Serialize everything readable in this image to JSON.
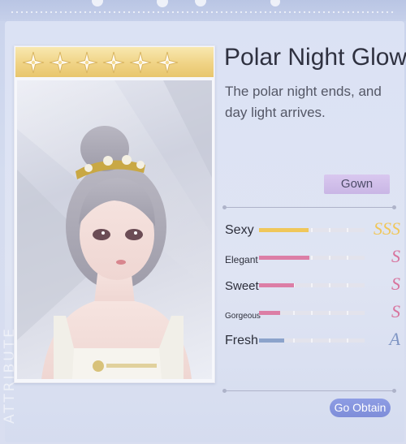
{
  "side_text": "ATTRIBUTE",
  "card": {
    "star_count": 6,
    "star_icon": "sparkle-star-icon"
  },
  "outfit": {
    "title": "Polar Night Glow",
    "description": "The polar night ends, and day light arrives.",
    "category": "Gown"
  },
  "attributes": [
    {
      "name": "Sexy",
      "grade": "SSS",
      "fill": 0.47,
      "color": "#f0c75a",
      "grade_color": "#f0c75a",
      "font_size": 16
    },
    {
      "name": "Elegant",
      "grade": "S",
      "fill": 0.48,
      "color": "#dc7ea6",
      "grade_color": "#d8739d",
      "font_size": 12
    },
    {
      "name": "Sweet",
      "grade": "S",
      "fill": 0.33,
      "color": "#dc7ea6",
      "grade_color": "#d8739d",
      "font_size": 15
    },
    {
      "name": "Gorgeous",
      "grade": "S",
      "fill": 0.2,
      "color": "#dc7ea6",
      "grade_color": "#d8739d",
      "font_size": 10
    },
    {
      "name": "Fresh",
      "grade": "A",
      "fill": 0.24,
      "color": "#8ca3cb",
      "grade_color": "#7f95c4",
      "font_size": 16
    }
  ],
  "button": {
    "go_obtain": "Go Obtain"
  }
}
